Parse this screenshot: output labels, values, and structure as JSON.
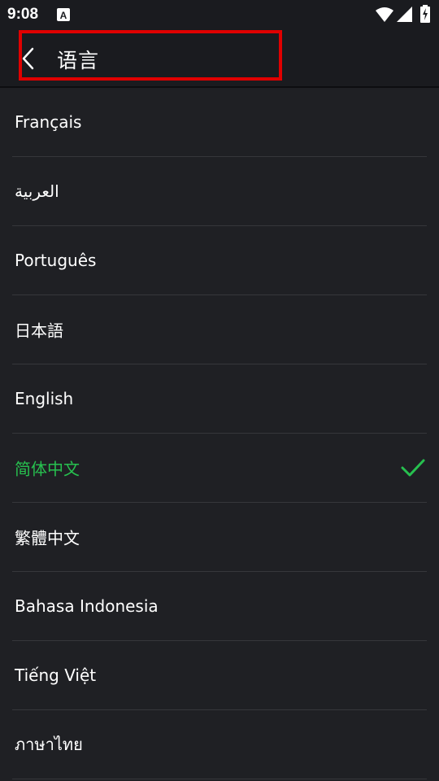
{
  "status_bar": {
    "time": "9:08",
    "notification_icon": "a-icon",
    "wifi_icon": "wifi-icon",
    "signal_icon": "signal-icon",
    "battery_icon": "battery-charging-icon"
  },
  "toolbar": {
    "back_icon": "chevron-left-icon",
    "title": "语言"
  },
  "languages": [
    {
      "label": "Français",
      "selected": false
    },
    {
      "label": "العربية",
      "selected": false
    },
    {
      "label": "Português",
      "selected": false
    },
    {
      "label": "日本語",
      "selected": false
    },
    {
      "label": "English",
      "selected": false
    },
    {
      "label": "简体中文",
      "selected": true
    },
    {
      "label": "繁體中文",
      "selected": false
    },
    {
      "label": "Bahasa Indonesia",
      "selected": false
    },
    {
      "label": "Tiếng Việt",
      "selected": false
    },
    {
      "label": "ภาษาไทย",
      "selected": false
    }
  ],
  "colors": {
    "background": "#1f2024",
    "selected": "#27c04f",
    "highlight": "#e00000"
  }
}
